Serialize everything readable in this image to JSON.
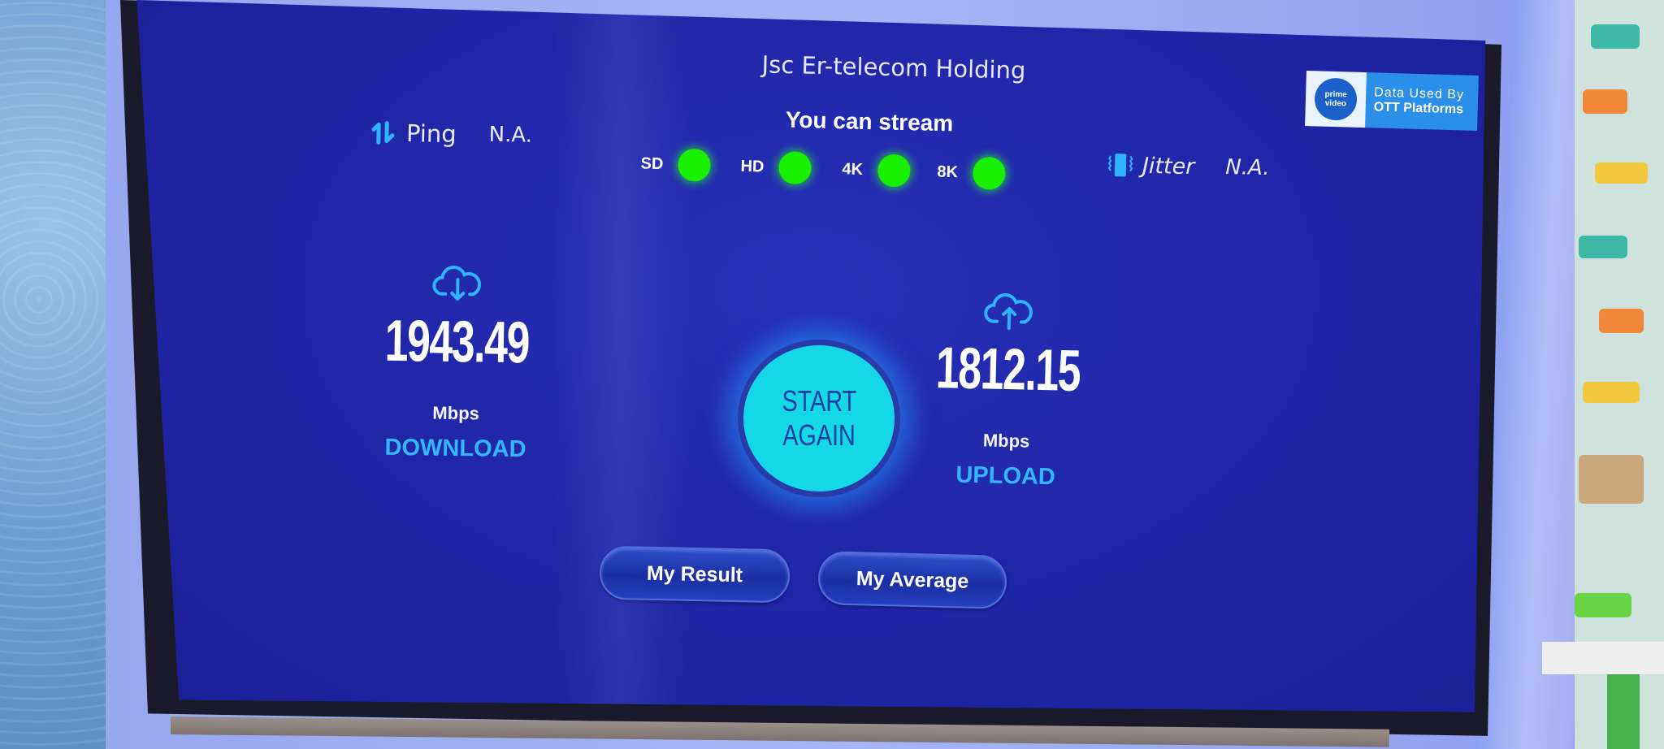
{
  "app": {
    "isp_name": "Jsc Er-telecom Holding"
  },
  "ping": {
    "icon": "ping-arrows-icon",
    "label": "Ping",
    "value": "N.A."
  },
  "jitter": {
    "icon": "jitter-vibration-icon",
    "label": "Jitter",
    "value": "N.A."
  },
  "streaming": {
    "title": "You can stream",
    "qualities": [
      {
        "label": "SD",
        "status": "available",
        "color": "#19f000"
      },
      {
        "label": "HD",
        "status": "available",
        "color": "#19f000"
      },
      {
        "label": "4K",
        "status": "available",
        "color": "#19f000"
      },
      {
        "label": "8K",
        "status": "available",
        "color": "#19f000"
      }
    ]
  },
  "badge": {
    "logo_line1": "prime",
    "logo_line2": "video",
    "line1": "Data Used By",
    "line2": "OTT Platforms"
  },
  "download": {
    "icon": "cloud-download-icon",
    "value": "1943.49",
    "unit": "Mbps",
    "label": "DOWNLOAD"
  },
  "upload": {
    "icon": "cloud-upload-icon",
    "value": "1812.15",
    "unit": "Mbps",
    "label": "UPLOAD"
  },
  "actions": {
    "start_line1": "START",
    "start_line2": "AGAIN",
    "my_result": "My Result",
    "my_average": "My Average"
  },
  "colors": {
    "background": "#1f25a6",
    "accent": "#33b7ff",
    "start_button": "#14d8e8",
    "stream_ok": "#19f000"
  }
}
